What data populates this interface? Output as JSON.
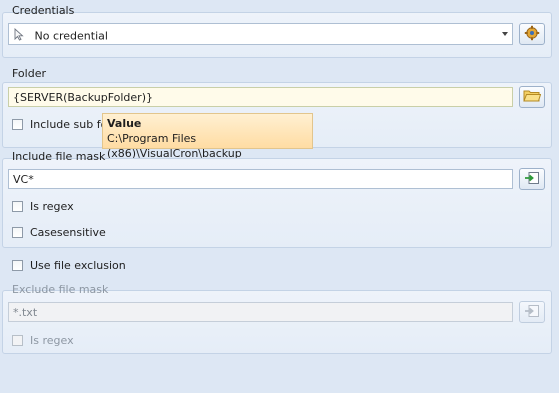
{
  "credentials": {
    "legend": "Credentials",
    "value": "No credential",
    "pointer_icon": "cursor-pointer-icon",
    "settings_icon": "gear-settings-icon"
  },
  "folder": {
    "legend": "Folder",
    "value": "{SERVER(BackupFolder)}",
    "include_sub_label": "Include sub fo",
    "browse_icon": "folder-icon"
  },
  "tooltip": {
    "title": "Value",
    "text": "C:\\Program Files (x86)\\VisualCron\\backup"
  },
  "include_mask": {
    "legend": "Include file mask",
    "value": "VC*",
    "is_regex_label": "Is regex",
    "casesensitive_label": "Casesensitive",
    "insert_icon": "insert-variable-icon"
  },
  "use_exclusion": {
    "label": "Use file exclusion"
  },
  "exclude_mask": {
    "legend": "Exclude file mask",
    "value": "*.txt",
    "is_regex_label": "Is regex",
    "insert_icon": "insert-variable-icon"
  }
}
